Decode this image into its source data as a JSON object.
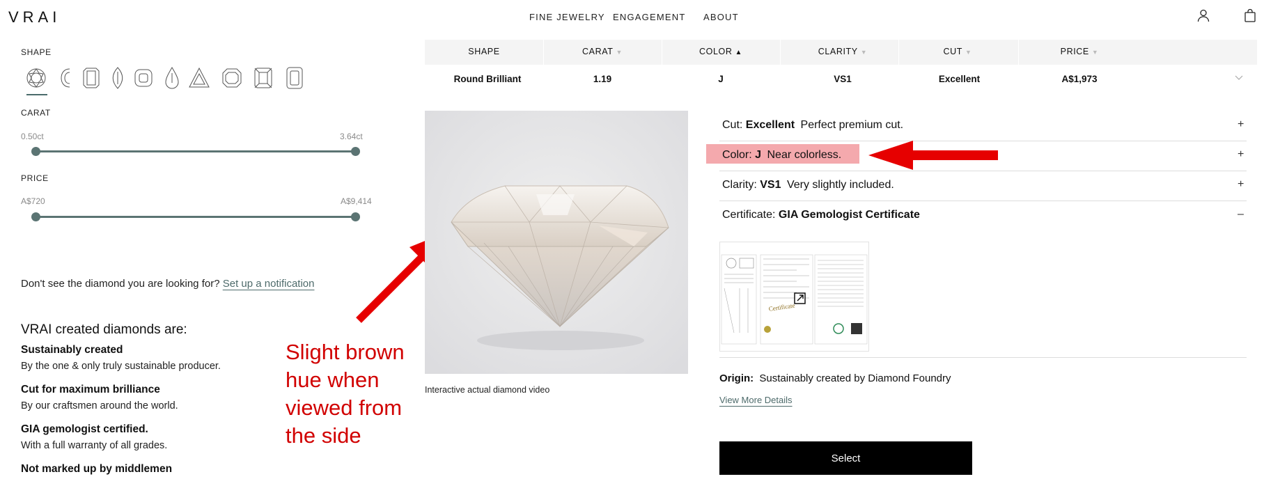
{
  "header": {
    "logo": "VRAI",
    "nav": [
      "FINE JEWELRY",
      "ENGAGEMENT",
      "ABOUT"
    ],
    "icons": [
      "account-icon",
      "bag-icon"
    ]
  },
  "filters": {
    "shape_title": "SHAPE",
    "shapes": [
      "round",
      "cushion-c",
      "emerald",
      "marquise",
      "cushion",
      "pear",
      "trillion",
      "asscher",
      "radiant",
      "elongated"
    ],
    "carat_title": "CARAT",
    "carat_min": "0.50ct",
    "carat_max": "3.64ct",
    "price_title": "PRICE",
    "price_min": "A$720",
    "price_max": "A$9,414"
  },
  "notify": {
    "text": "Don't see the diamond you are looking for?",
    "link": "Set up a notification"
  },
  "benefits": {
    "heading": "VRAI created diamonds are:",
    "items": [
      {
        "title": "Sustainably created",
        "desc": "By the one & only truly sustainable producer."
      },
      {
        "title": "Cut for maximum brilliance",
        "desc": "By our craftsmen around the world."
      },
      {
        "title": "GIA gemologist certified.",
        "desc": "With a full warranty of all grades."
      },
      {
        "title": "Not marked up by middlemen",
        "desc": ""
      }
    ]
  },
  "table": {
    "columns": [
      "SHAPE",
      "CARAT",
      "COLOR",
      "CLARITY",
      "CUT",
      "PRICE"
    ],
    "sort_active": "COLOR",
    "row": [
      "Round Brilliant",
      "1.19",
      "J",
      "VS1",
      "Excellent",
      "A$1,973"
    ]
  },
  "media": {
    "caption": "Interactive actual diamond video"
  },
  "details": {
    "cut": {
      "label": "Cut:",
      "grade": "Excellent",
      "desc": "Perfect premium cut."
    },
    "color": {
      "label": "Color:",
      "grade": "J",
      "desc": "Near colorless."
    },
    "clarity": {
      "label": "Clarity:",
      "grade": "VS1",
      "desc": "Very slightly included."
    },
    "certificate": {
      "label": "Certificate:",
      "grade": "GIA Gemologist Certificate"
    },
    "origin": {
      "label": "Origin:",
      "desc": "Sustainably created by Diamond Foundry"
    },
    "more_link": "View More Details",
    "select_label": "Select"
  },
  "annotation": {
    "text": "Slight brown hue when viewed from the side",
    "color": "#d10000",
    "highlight_color": "#f4a9ad"
  }
}
